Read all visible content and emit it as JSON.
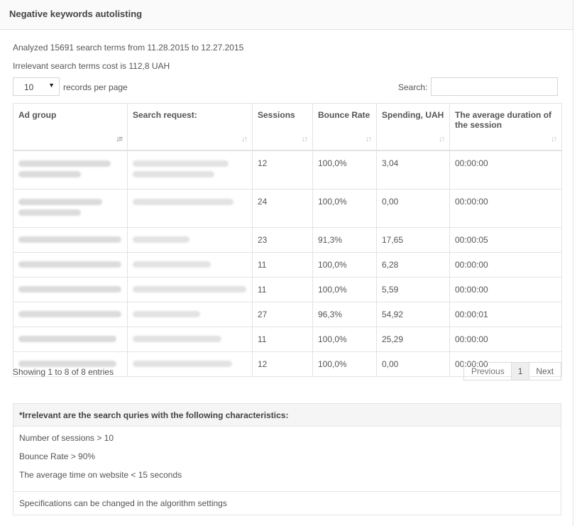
{
  "panel": {
    "title": "Negative keywords autolisting"
  },
  "info": {
    "analyzed": "Analyzed 15691 search terms from 11.28.2015 to 12.27.2015",
    "cost": "Irrelevant search terms cost is 112,8 UAH"
  },
  "controls": {
    "page_length_value": "10",
    "page_length_label": "records per page",
    "search_label": "Search:",
    "search_value": ""
  },
  "table": {
    "headers": [
      "Ad group",
      "Search request:",
      "Sessions",
      "Bounce Rate",
      "Spending, UAH",
      "The average duration of the session"
    ],
    "rows": [
      {
        "sessions": "12",
        "bounce": "100,0%",
        "spending": "3,04",
        "duration": "00:00:00"
      },
      {
        "sessions": "24",
        "bounce": "100,0%",
        "spending": "0,00",
        "duration": "00:00:00"
      },
      {
        "sessions": "23",
        "bounce": "91,3%",
        "spending": "17,65",
        "duration": "00:00:05"
      },
      {
        "sessions": "11",
        "bounce": "100,0%",
        "spending": "6,28",
        "duration": "00:00:00"
      },
      {
        "sessions": "11",
        "bounce": "100,0%",
        "spending": "5,59",
        "duration": "00:00:00"
      },
      {
        "sessions": "27",
        "bounce": "96,3%",
        "spending": "54,92",
        "duration": "00:00:01"
      },
      {
        "sessions": "11",
        "bounce": "100,0%",
        "spending": "25,29",
        "duration": "00:00:00"
      },
      {
        "sessions": "12",
        "bounce": "100,0%",
        "spending": "0,00",
        "duration": "00:00:00"
      }
    ]
  },
  "footer": {
    "showing": "Showing 1 to 8 of 8 entries",
    "previous": "Previous",
    "page": "1",
    "next": "Next"
  },
  "note": {
    "title": "*Irrelevant are the search quries with the following characteristics:",
    "criteria": [
      "Number of sessions > 10",
      "Bounce Rate > 90%",
      "The average time on website < 15 seconds"
    ],
    "footer": "Specifications can be changed in the algorithm settings"
  }
}
